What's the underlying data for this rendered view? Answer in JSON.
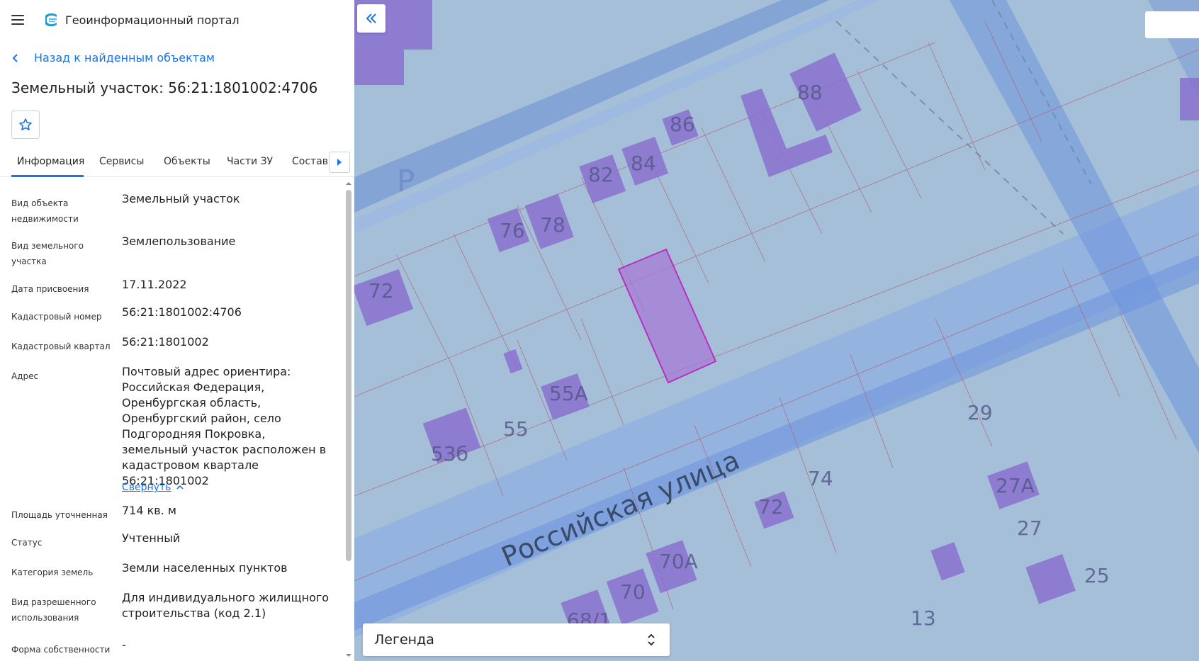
{
  "app": {
    "title": "Геоинформационный портал"
  },
  "nav": {
    "back_label": "Назад к найденным объектам"
  },
  "page": {
    "title": "Земельный участок: 56:21:1801002:4706"
  },
  "tabs": [
    {
      "label": "Информация",
      "active": true
    },
    {
      "label": "Сервисы"
    },
    {
      "label": "Объекты"
    },
    {
      "label": "Части ЗУ"
    },
    {
      "label": "Состав"
    }
  ],
  "info": [
    {
      "label": "Вид объекта недвижимости",
      "value": "Земельный участок"
    },
    {
      "label": "Вид земельного участка",
      "value": "Землепользование"
    },
    {
      "label": "Дата присвоения",
      "value": "17.11.2022"
    },
    {
      "label": "Кадастровый номер",
      "value": "56:21:1801002:4706"
    },
    {
      "label": "Кадастровый квартал",
      "value": "56:21:1801002"
    },
    {
      "label": "Адрес",
      "value": "Почтовый адрес ориентира: Российская Федерация, Оренбургская область, Оренбургский район, село Подгородняя Покровка, земельный участок расположен в кадастровом квартале 56:21:1801002"
    },
    {
      "label": "Площадь уточненная",
      "value": "714 кв. м"
    },
    {
      "label": "Статус",
      "value": "Учтенный"
    },
    {
      "label": "Категория земель",
      "value": "Земли населенных пунктов"
    },
    {
      "label": "Вид разрешенного использования",
      "value": "Для индивидуального жилищного строительства (код 2.1)"
    },
    {
      "label": "Форма собственности",
      "value": "-"
    }
  ],
  "address_toggle": "Свернуть",
  "map": {
    "street_label": "Российская улица",
    "zone_label": "Р",
    "house_numbers": [
      "88",
      "86",
      "84",
      "82",
      "78",
      "76",
      "72",
      "55А",
      "55",
      "53б",
      "29",
      "74",
      "72",
      "27А",
      "27",
      "70А",
      "70",
      "68/1",
      "13",
      "25"
    ]
  },
  "legend": {
    "label": "Легенда"
  },
  "colors": {
    "accent": "#1a73e8",
    "map_bg": "#a5bfd8",
    "building": "#8b74cf",
    "selected_parcel": "#c000b8"
  },
  "icons": {
    "menu": "menu-icon",
    "logo": "logo-icon",
    "back": "chevron-left-icon",
    "favorite": "star-icon",
    "tabs_next": "triangle-right-icon",
    "collapse_panel": "double-chevron-left-icon",
    "collapse_address": "chevron-up-icon",
    "legend_toggle": "updown-chevron-icon"
  }
}
